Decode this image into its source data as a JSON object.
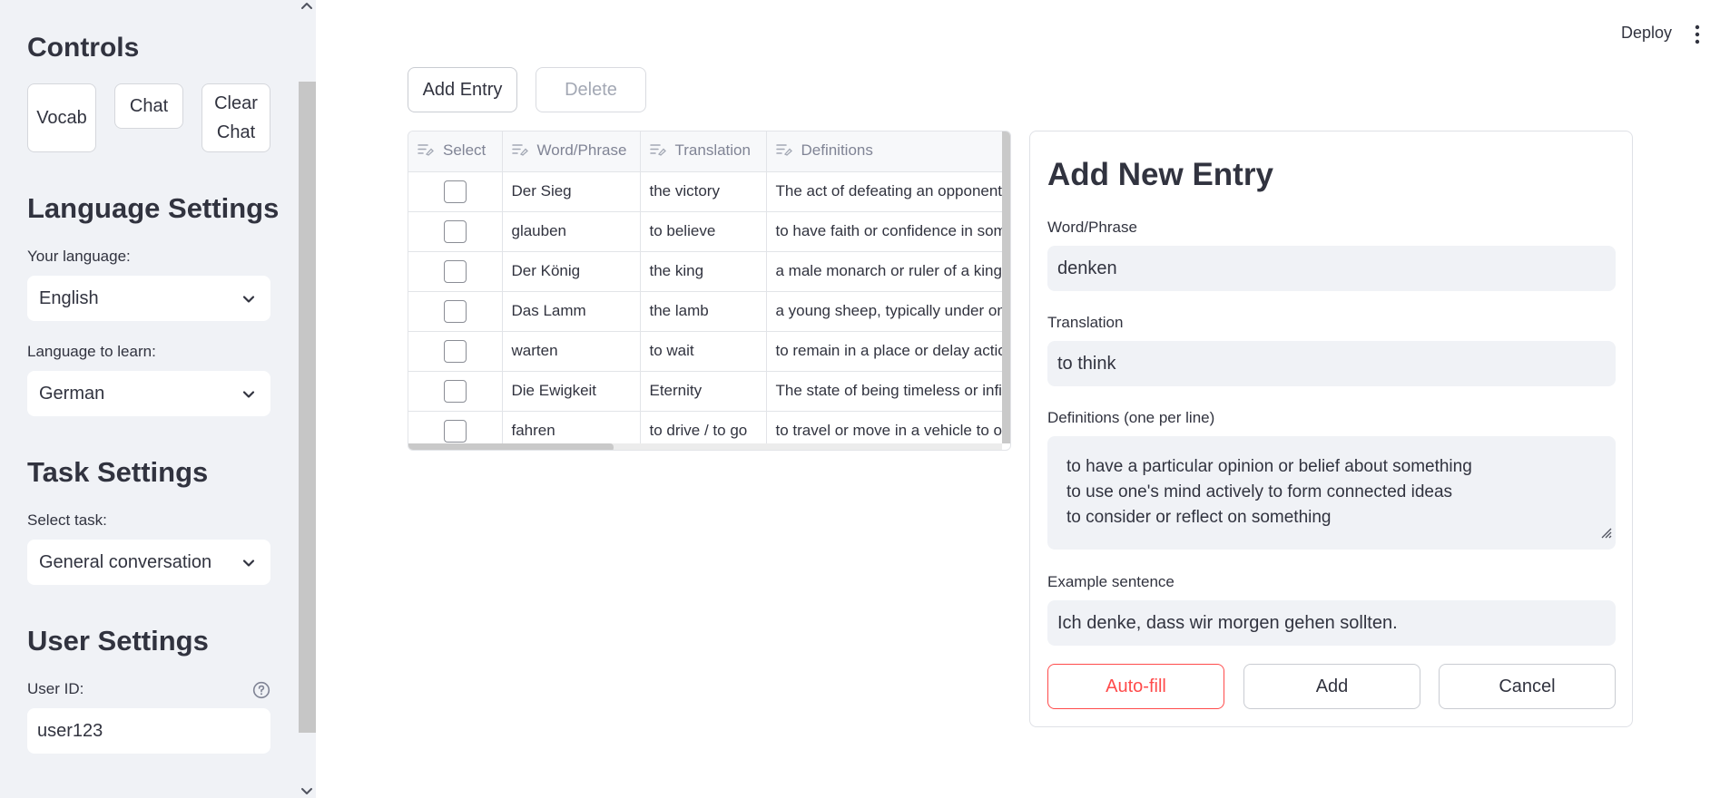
{
  "sidebar": {
    "controls_heading": "Controls",
    "buttons": {
      "vocab": "Vocab",
      "chat": "Chat",
      "clear_chat": "Clear Chat"
    },
    "language_heading": "Language Settings",
    "your_language_label": "Your language:",
    "your_language_value": "English",
    "learn_language_label": "Language to learn:",
    "learn_language_value": "German",
    "task_heading": "Task Settings",
    "task_label": "Select task:",
    "task_value": "General conversation",
    "user_heading": "User Settings",
    "user_id_label": "User ID:",
    "user_id_value": "user123"
  },
  "header": {
    "deploy_label": "Deploy"
  },
  "toolbar": {
    "add_entry_label": "Add Entry",
    "delete_label": "Delete"
  },
  "table": {
    "columns": [
      "Select",
      "Word/Phrase",
      "Translation",
      "Definitions"
    ],
    "rows": [
      {
        "word": "Der Sieg",
        "translation": "the victory",
        "definition": "The act of defeating an opponent or"
      },
      {
        "word": "glauben",
        "translation": "to believe",
        "definition": "to have faith or confidence in some"
      },
      {
        "word": "Der König",
        "translation": "the king",
        "definition": "a male monarch or ruler of a kingdom"
      },
      {
        "word": "Das Lamm",
        "translation": "the lamb",
        "definition": "a young sheep, typically under one"
      },
      {
        "word": "warten",
        "translation": "to wait",
        "definition": "to remain in a place or delay action"
      },
      {
        "word": "Die Ewigkeit",
        "translation": "Eternity",
        "definition": "The state of being timeless or infinite"
      },
      {
        "word": "fahren",
        "translation": "to drive / to go",
        "definition": "to travel or move in a vehicle to op"
      }
    ]
  },
  "form": {
    "title": "Add New Entry",
    "word_label": "Word/Phrase",
    "word_value": "denken",
    "translation_label": "Translation",
    "translation_value": "to think",
    "definitions_label": "Definitions (one per line)",
    "definitions": [
      "to have a particular opinion or belief about something",
      "to use one's mind actively to form connected ideas",
      "to consider or reflect on something"
    ],
    "example_label": "Example sentence",
    "example_value": "Ich denke, dass wir morgen gehen sollten.",
    "autofill_label": "Auto-fill",
    "add_label": "Add",
    "cancel_label": "Cancel"
  },
  "colors": {
    "accent": "#ff4b4b",
    "sidebar_bg": "#f0f2f6",
    "text": "#31333f"
  }
}
